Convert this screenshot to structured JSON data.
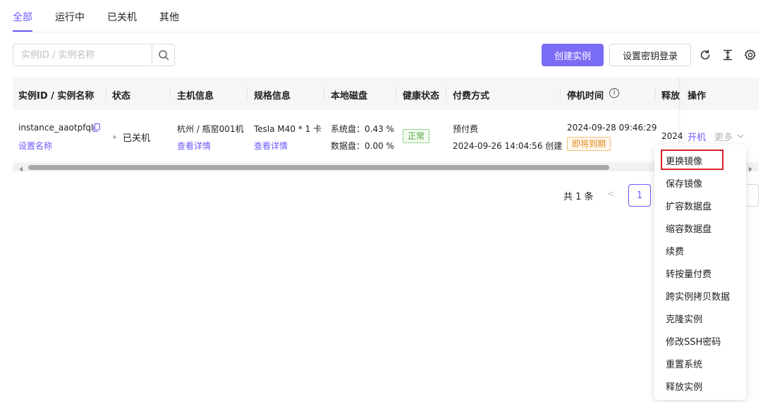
{
  "tabs": [
    {
      "label": "全部",
      "active": true
    },
    {
      "label": "运行中",
      "active": false
    },
    {
      "label": "已关机",
      "active": false
    },
    {
      "label": "其他",
      "active": false
    }
  ],
  "search": {
    "placeholder": "实例ID / 实例名称",
    "icon": "search-icon"
  },
  "toolbar": {
    "create_label": "创建实例",
    "set_key_label": "设置密钥登录",
    "icons": [
      "refresh-icon",
      "column-height-icon",
      "settings-icon"
    ]
  },
  "table": {
    "headers": {
      "id": "实例ID / 实例名称",
      "status": "状态",
      "host": "主机信息",
      "spec": "规格信息",
      "disk": "本地磁盘",
      "health": "健康状态",
      "billing": "付费方式",
      "stop_time": "停机时间",
      "release": "释放",
      "action": "操作"
    },
    "rows": [
      {
        "name": "instance_aaotpfql",
        "set_name": "设置名称",
        "status": "已关机",
        "host": "杭州 / 瓶窑001机",
        "host_link": "查看详情",
        "spec": "Tesla M40 * 1 卡",
        "spec_link": "查看详情",
        "disk_system": "系统盘：0.43 %",
        "disk_data": "数据盘：0.00 %",
        "health": "正常",
        "billing_type": "预付费",
        "created": "2024-09-26 14:04:56 创建",
        "stop_time": "2024-09-28 09:46:29",
        "expire_badge": "即将到期",
        "release": "2024",
        "action_start": "开机",
        "action_more": "更多"
      }
    ]
  },
  "pagination": {
    "total": "共 1 条",
    "prev": "<",
    "current": "1"
  },
  "more_menu": {
    "items": [
      "更换镜像",
      "保存镜像",
      "扩容数据盘",
      "缩容数据盘",
      "续费",
      "转按量付费",
      "跨实例拷贝数据",
      "克隆实例",
      "修改SSH密码",
      "重置系统",
      "释放实例"
    ],
    "highlighted_index": 0
  },
  "colors": {
    "accent": "#6a5af9",
    "primary_button": "#7b6cf6",
    "highlight_border": "#e0202a",
    "success": "#52a838",
    "warning": "#e38a1c"
  }
}
